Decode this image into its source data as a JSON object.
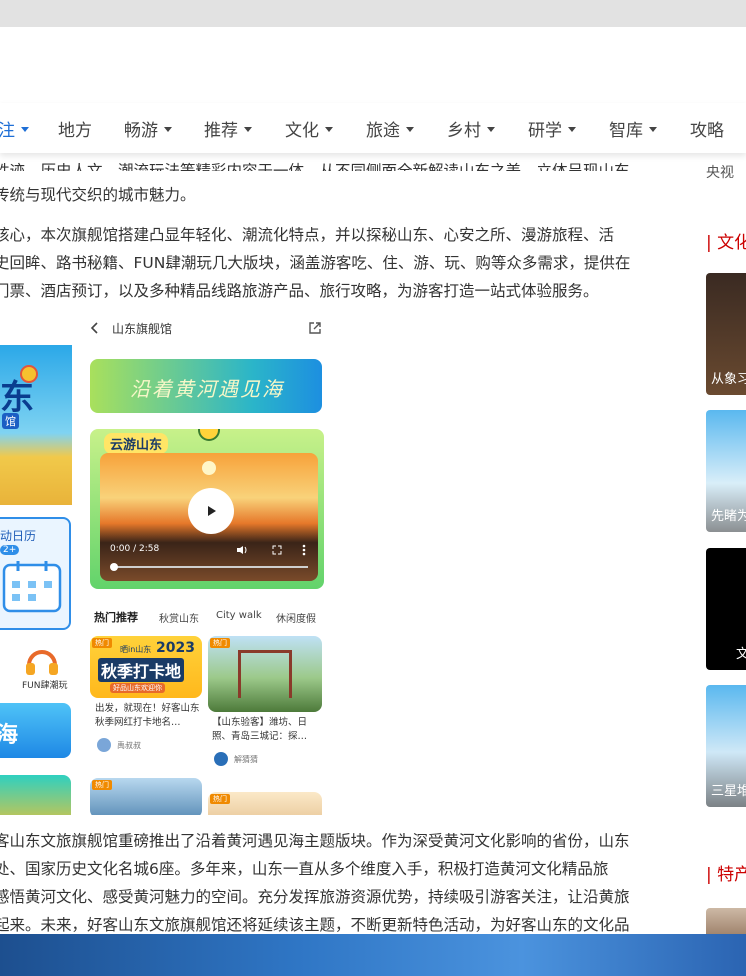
{
  "nav": {
    "items": [
      {
        "label": "注",
        "caret": true,
        "active": true
      },
      {
        "label": "地方",
        "caret": false
      },
      {
        "label": "畅游",
        "caret": true
      },
      {
        "label": "推荐",
        "caret": true
      },
      {
        "label": "文化",
        "caret": true
      },
      {
        "label": "旅途",
        "caret": true
      },
      {
        "label": "乡村",
        "caret": true
      },
      {
        "label": "研学",
        "caret": true
      },
      {
        "label": "智库",
        "caret": true
      },
      {
        "label": "攻略",
        "caret": false
      }
    ],
    "active_color": "#1f6fd6"
  },
  "article": {
    "para1_line1": "胜迹、历史人文、潮流玩法等精彩内容于一体，从不同侧面全新解读山东之美，立体呈现山东",
    "para1_line2": "传统与现代交织的城市魅力。",
    "para2_line1": "核心，本次旗舰馆搭建凸显年轻化、潮流化特点，并以探秘山东、心安之所、漫游旅程、活",
    "para2_line2": "史回眸、路书秘籍、FUN肆潮玩几大版块，涵盖游客吃、住、游、玩、购等众多需求，提供在",
    "para2_line3": "门票、酒店预订，以及多种精品线路旅游产品、旅行攻略，为游客打造一站式体验服务。",
    "para3_line1": "客山东文旅旗舰馆重磅推出了沿着黄河遇见海主题版块。作为深受黄河文化影响的省份，山东",
    "para3_line2": "处、国家历史文化名城6座。多年来，山东一直从多个维度入手，积极打造黄河文化精品旅",
    "para3_line3": "感悟黄河文化、感受黄河魅力的空间。充分发挥旅游资源优势，持续吸引游客关注，让沿黄旅",
    "para3_line4": "起来。未来，好客山东文旅旗舰馆还将延续该主题，不断更新特色活动，为好客山东的文化品"
  },
  "phone_left": {
    "banner_char": "东",
    "banner_sub": "馆",
    "calendar_label": "动日历",
    "calendar_sub": "2+",
    "fun_label": "FUN肆潮玩",
    "sea_text": "海"
  },
  "phone_right": {
    "header_title": "山东旗舰馆",
    "banner_text": "沿着黄河遇见海",
    "cloud_title": "云游山东",
    "video_time": "0:00 / 2:58",
    "tabs": [
      "热门推荐",
      "秋赏山东",
      "City walk",
      "休闲度假"
    ],
    "card1": {
      "tag": "热门",
      "poster_title": "秋季打卡地",
      "poster_year": "2023",
      "poster_top": "晒in山东",
      "poster_bottom": "好品山东欢迎你",
      "desc": "出发，就现在！好客山东秋季网红打卡地名…",
      "author": "禹叔叔"
    },
    "card2": {
      "tag": "热门",
      "desc": "【山东验客】潍坊、日照、青岛三城记：探…",
      "author": "解猜猜"
    },
    "card3": {
      "tag": "热门"
    },
    "card4": {
      "tag": "热门"
    }
  },
  "sidebar": {
    "top_text": "央视",
    "section1": "| 文化",
    "thumbs": [
      "从象习",
      "先睹为",
      "文",
      "三星堆"
    ],
    "section2": "| 特产"
  }
}
